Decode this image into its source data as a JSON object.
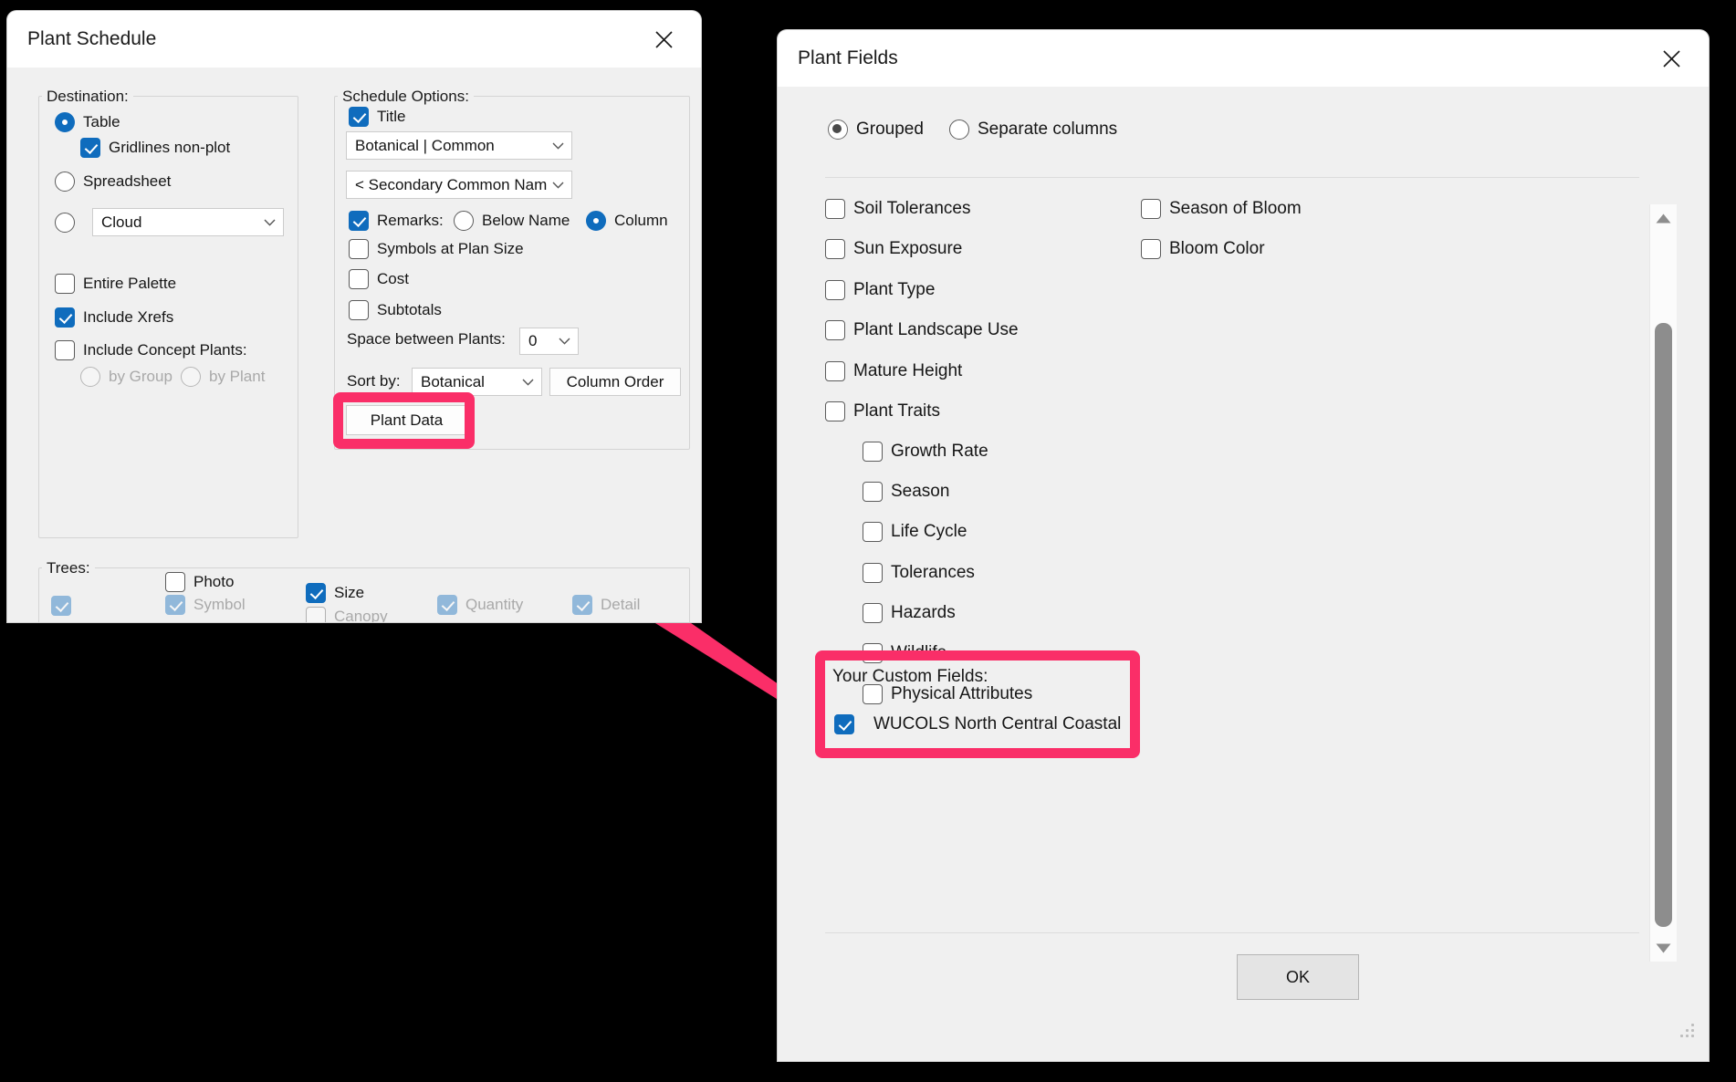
{
  "plant_schedule": {
    "title": "Plant Schedule",
    "close_icon": "close-icon",
    "destination": {
      "group_label": "Destination:",
      "options": [
        {
          "label": "Table",
          "selected": true
        },
        {
          "label": "Spreadsheet",
          "selected": false
        },
        {
          "label": "Cloud",
          "selected": false
        }
      ],
      "gridlines": {
        "label": "Gridlines non-plot",
        "checked": true
      },
      "cloud_combo_value": "Cloud",
      "checkboxes": [
        {
          "label": "Entire Palette",
          "checked": false
        },
        {
          "label": "Include Xrefs",
          "checked": true
        },
        {
          "label": "Include Concept Plants:",
          "checked": false
        }
      ],
      "concept_radios": [
        {
          "label": "by Group",
          "selected": false,
          "disabled": true
        },
        {
          "label": "by Plant",
          "selected": false,
          "disabled": true
        }
      ]
    },
    "schedule_options": {
      "group_label": "Schedule Options:",
      "title_checkbox": {
        "label": "Title",
        "checked": true
      },
      "name_format_combo": "Botanical  |  Common",
      "secondary_name_combo": "< Secondary Common Name",
      "remarks": {
        "label": "Remarks:",
        "checked": true
      },
      "remarks_radios": [
        {
          "label": "Below Name",
          "selected": false
        },
        {
          "label": "Column",
          "selected": true
        }
      ],
      "checkboxes": [
        {
          "label": "Symbols at Plan Size",
          "checked": false
        },
        {
          "label": "Cost",
          "checked": false
        },
        {
          "label": "Subtotals",
          "checked": false
        }
      ],
      "space_label": "Space between Plants:",
      "space_value": "0",
      "sort_label": "Sort by:",
      "sort_value": "Botanical",
      "column_order_button": "Column Order",
      "plant_data_button": "Plant Data"
    },
    "trees": {
      "group_label": "Trees:",
      "items": [
        {
          "label": "Photo",
          "checked": false,
          "disabled": false
        },
        {
          "label": "Symbol",
          "checked": true,
          "disabled": true
        },
        {
          "label": "Size",
          "checked": true,
          "disabled": false
        },
        {
          "label": "Canopy",
          "checked": false,
          "disabled": true
        },
        {
          "label": "Quantity",
          "checked": true,
          "disabled": true
        },
        {
          "label": "Detail",
          "checked": true,
          "disabled": true
        }
      ]
    }
  },
  "plant_fields": {
    "title": "Plant Fields",
    "close_icon": "close-icon",
    "layout_radios": [
      {
        "label": "Grouped",
        "selected": true
      },
      {
        "label": "Separate columns",
        "selected": false
      }
    ],
    "fields_left": [
      {
        "label": "Soil Tolerances",
        "checked": false,
        "indent": false
      },
      {
        "label": "Sun Exposure",
        "checked": false,
        "indent": false
      },
      {
        "label": "Plant Type",
        "checked": false,
        "indent": false
      },
      {
        "label": "Plant Landscape Use",
        "checked": false,
        "indent": false
      },
      {
        "label": "Mature Height",
        "checked": false,
        "indent": false
      },
      {
        "label": "Plant Traits",
        "checked": false,
        "indent": false
      },
      {
        "label": "Growth Rate",
        "checked": false,
        "indent": true
      },
      {
        "label": "Season",
        "checked": false,
        "indent": true
      },
      {
        "label": "Life Cycle",
        "checked": false,
        "indent": true
      },
      {
        "label": "Tolerances",
        "checked": false,
        "indent": true
      },
      {
        "label": "Hazards",
        "checked": false,
        "indent": true
      },
      {
        "label": "Wildlife",
        "checked": false,
        "indent": true
      },
      {
        "label": "Physical Attributes",
        "checked": false,
        "indent": true
      }
    ],
    "fields_right": [
      {
        "label": "Season of Bloom",
        "checked": false
      },
      {
        "label": "Bloom Color",
        "checked": false
      }
    ],
    "custom_fields": {
      "heading": "Your Custom Fields:",
      "items": [
        {
          "label": "WUCOLS North Central Coastal",
          "checked": true
        }
      ]
    },
    "ok_button": "OK",
    "scrollbar": {
      "up_icon": "scroll-up-arrow-icon",
      "down_icon": "scroll-down-arrow-icon"
    },
    "resize_grip_icon": "resize-grip-icon"
  },
  "annotation": {
    "color": "#fa2e68",
    "arrow_icon": "callout-arrow-icon",
    "highlight_targets": [
      "plant-data-button",
      "your-custom-fields-panel"
    ]
  }
}
